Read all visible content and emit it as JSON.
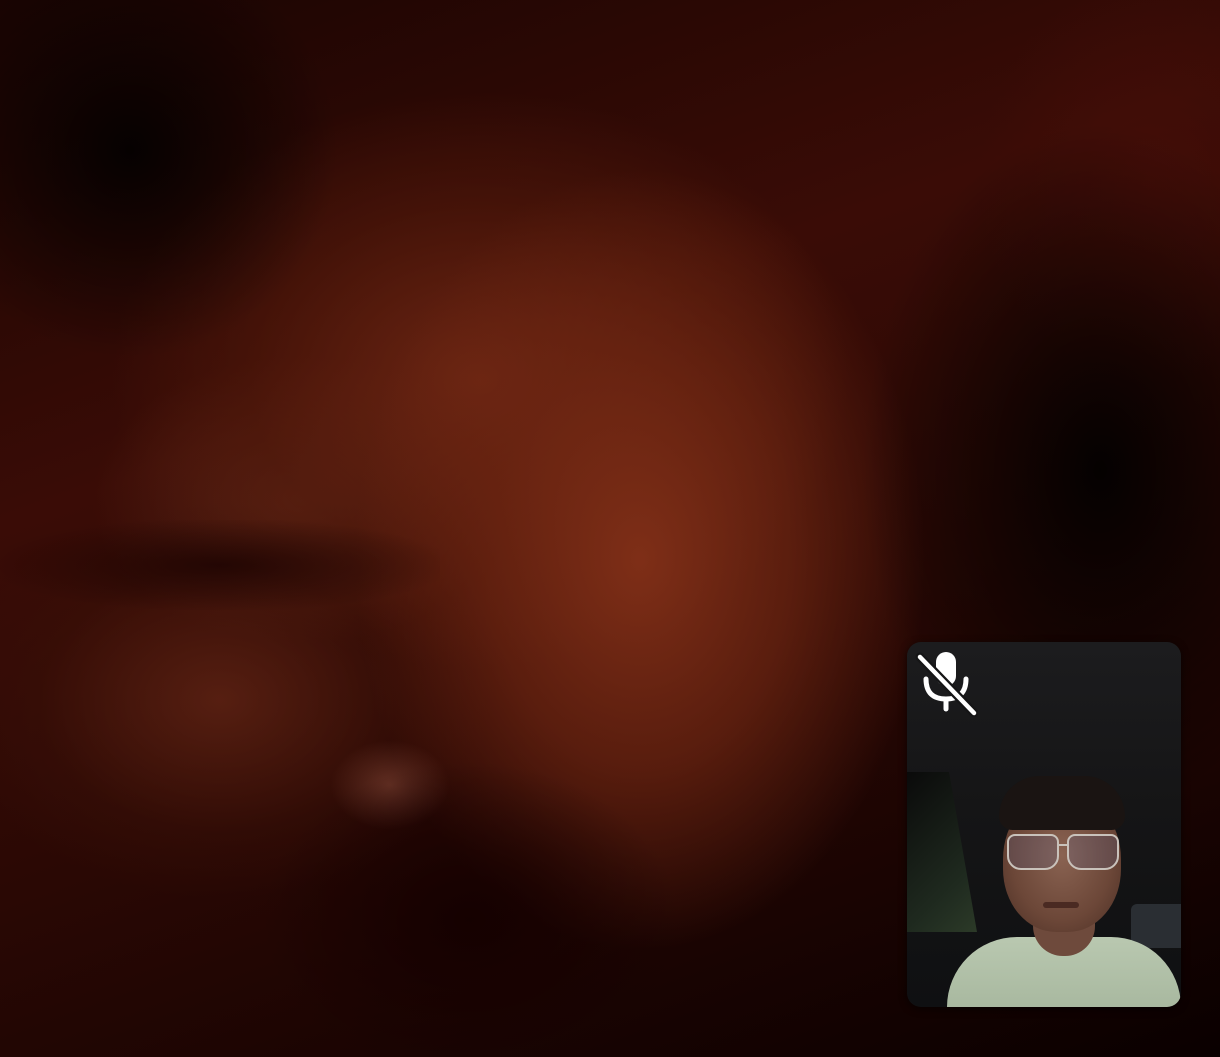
{
  "call": {
    "remote_video": {
      "content": "blurred-remote-camera-feed",
      "tint": "#6e2616"
    },
    "self_view": {
      "mic_state": "muted",
      "mic_icon": "microphone-muted-icon",
      "icon_color": "#ffffff",
      "background": "#151516"
    }
  }
}
